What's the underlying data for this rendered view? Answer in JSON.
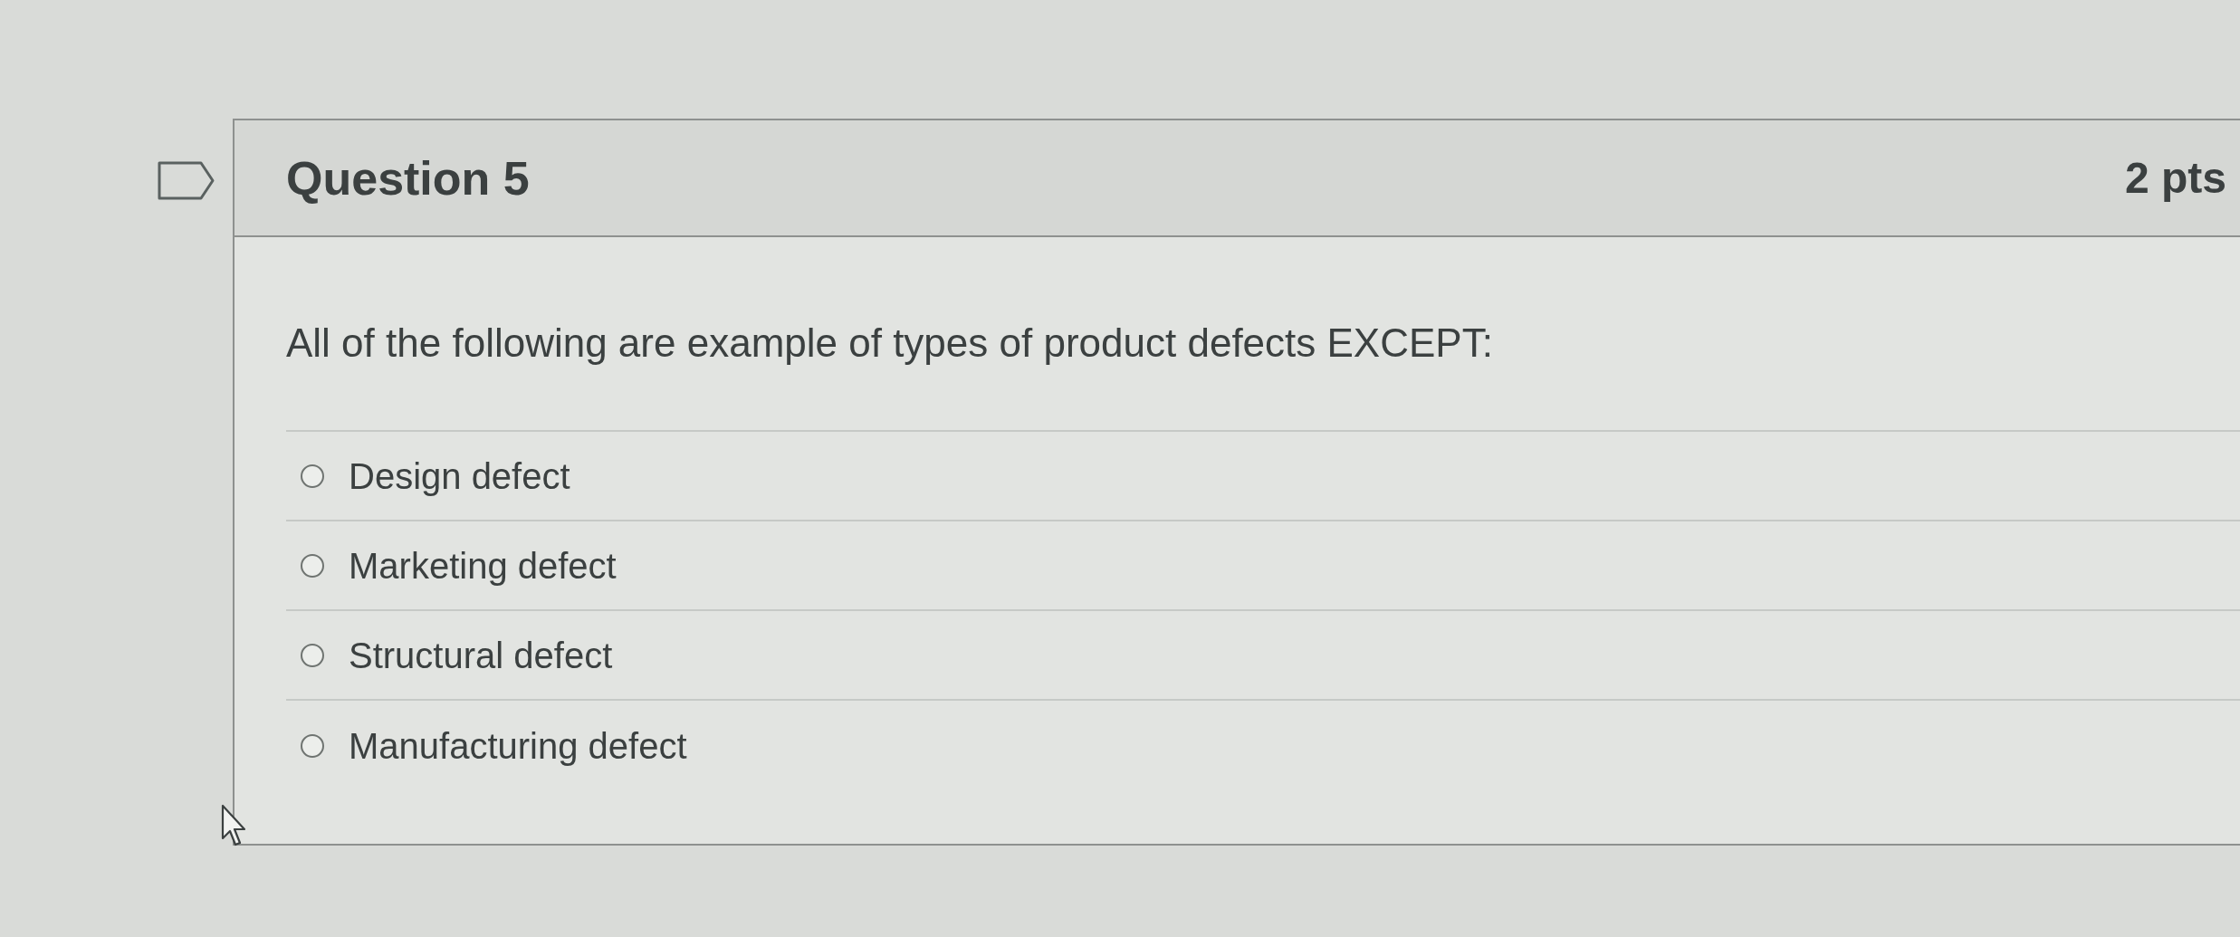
{
  "question": {
    "title": "Question 5",
    "points": "2 pts",
    "flagged": false,
    "prompt": "All of the following are example of types of product defects EXCEPT:",
    "options": [
      {
        "label": "Design defect",
        "selected": false
      },
      {
        "label": "Marketing defect",
        "selected": false
      },
      {
        "label": "Structural defect",
        "selected": false
      },
      {
        "label": "Manufacturing defect",
        "selected": false
      }
    ]
  }
}
